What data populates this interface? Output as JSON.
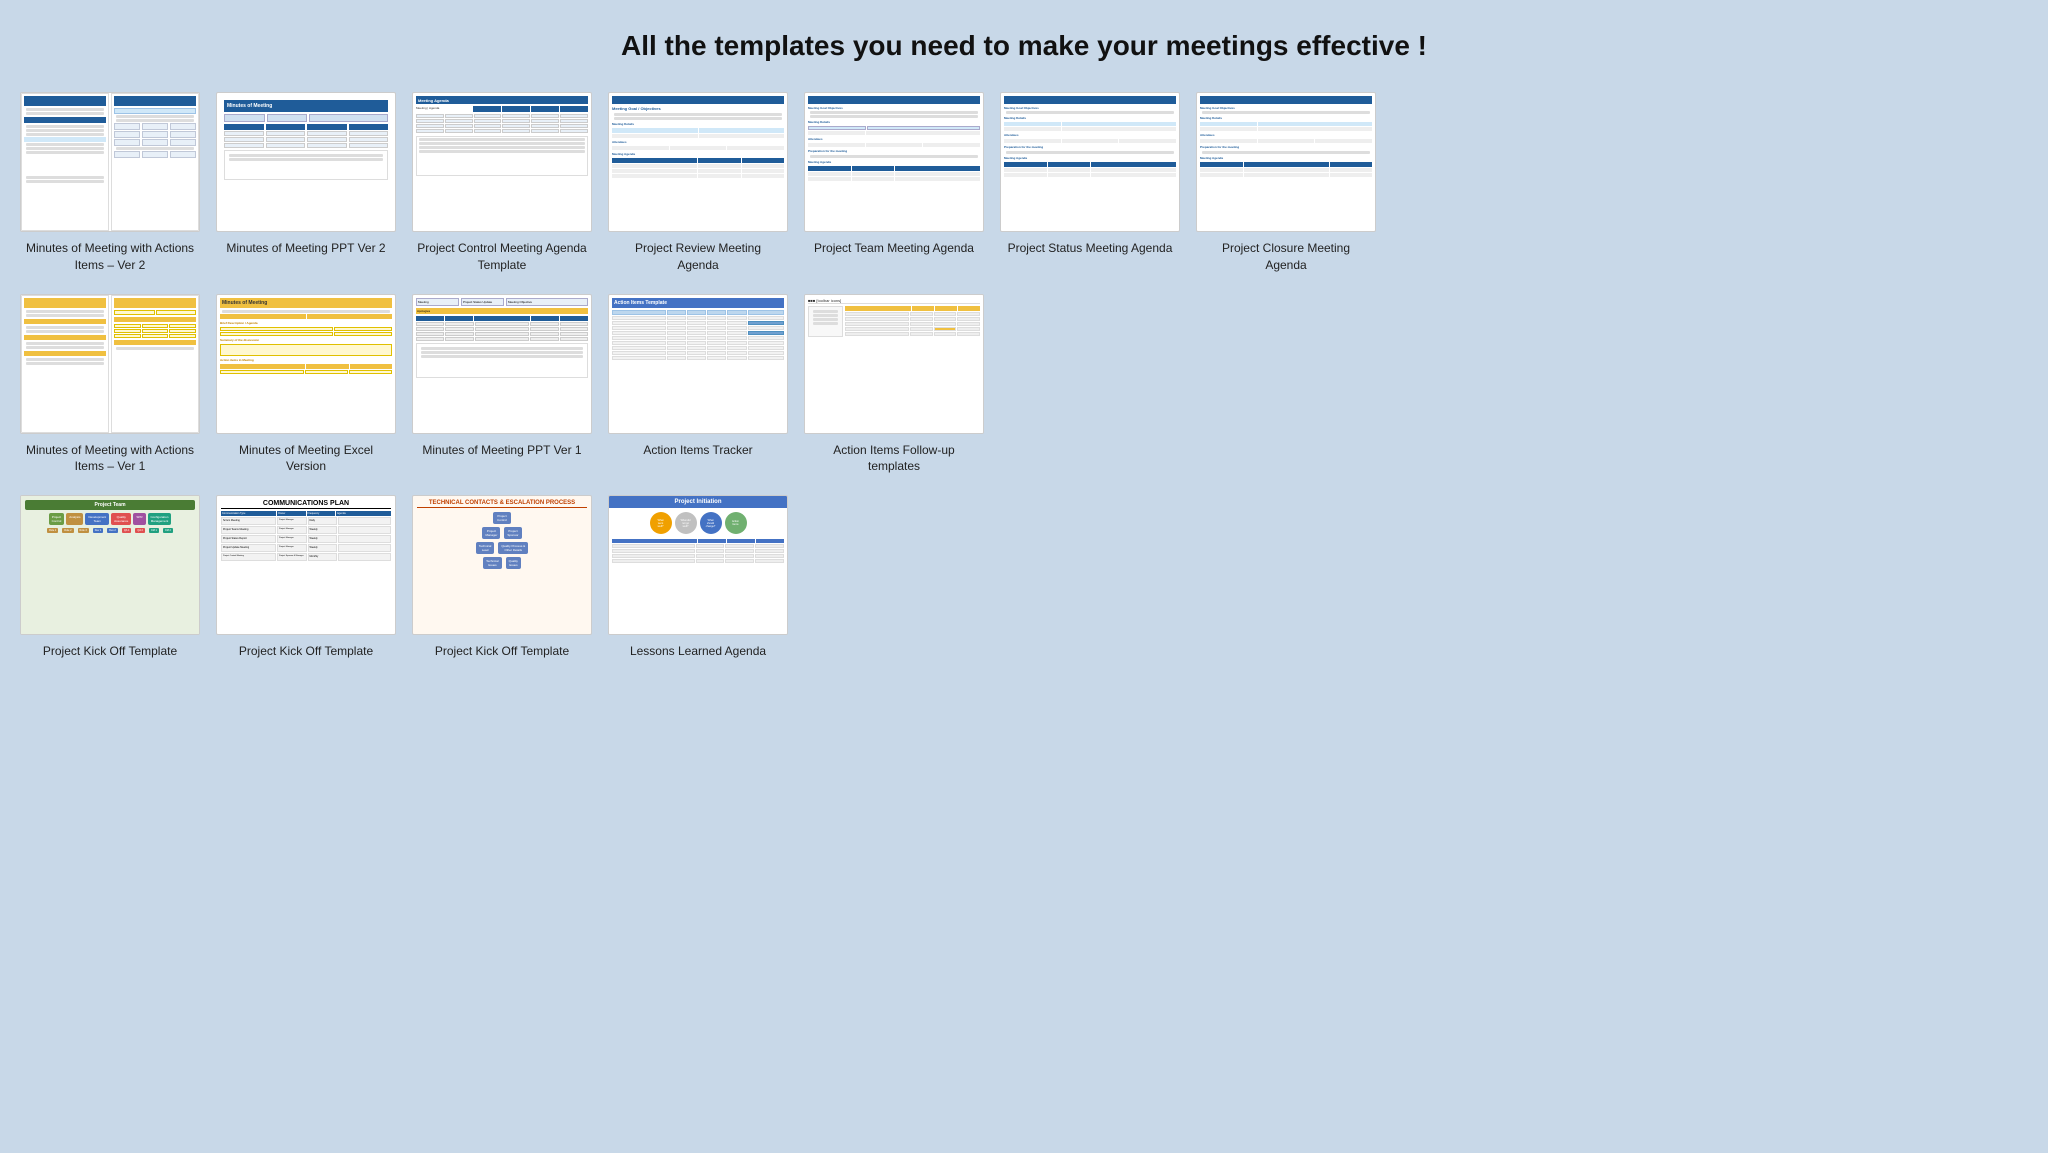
{
  "page": {
    "title": "All the templates you need to make your meetings effective !",
    "background_color": "#c8d8e8"
  },
  "rows": [
    {
      "id": "row1",
      "cards": [
        {
          "id": "c1",
          "label": "Minutes of Meeting with Actions Items – Ver 2",
          "thumb_type": "double-blue"
        },
        {
          "id": "c2",
          "label": "Minutes of Meeting PPT Ver 2",
          "thumb_type": "ppt-blue"
        },
        {
          "id": "c3",
          "label": "Project Control Meeting Agenda Template",
          "thumb_type": "blue-table"
        },
        {
          "id": "c4",
          "label": "Project Review Meeting Agenda",
          "thumb_type": "blue-table2"
        },
        {
          "id": "c5",
          "label": "Project Team Meeting Agenda",
          "thumb_type": "blue-table3"
        },
        {
          "id": "c6",
          "label": "Project Status Meeting Agenda",
          "thumb_type": "blue-table4"
        },
        {
          "id": "c7",
          "label": "Project Closure Meeting Agenda",
          "thumb_type": "blue-table5"
        }
      ]
    },
    {
      "id": "row2",
      "cards": [
        {
          "id": "c8",
          "label": "Minutes of Meeting with Actions Items – Ver 1",
          "thumb_type": "double-yellow"
        },
        {
          "id": "c9",
          "label": "Minutes of Meeting Excel Version",
          "thumb_type": "yellow-table"
        },
        {
          "id": "c10",
          "label": "Minutes of Meeting PPT Ver 1",
          "thumb_type": "ppt-meeting"
        },
        {
          "id": "c11",
          "label": "Action Items Tracker",
          "thumb_type": "action-tracker"
        },
        {
          "id": "c12",
          "label": "Action Items Follow-up templates",
          "thumb_type": "action-followup"
        }
      ]
    },
    {
      "id": "row3",
      "cards": [
        {
          "id": "c13",
          "label": "Project Kick Off Template",
          "thumb_type": "kickoff-org"
        },
        {
          "id": "c14",
          "label": "Project Kick Off Template",
          "thumb_type": "kickoff-comms"
        },
        {
          "id": "c15",
          "label": "Project Kick Off Template",
          "thumb_type": "kickoff-escalation"
        },
        {
          "id": "c16",
          "label": "Lessons Learned Agenda",
          "thumb_type": "lessons-learned"
        }
      ]
    }
  ],
  "colors": {
    "blue_dark": "#1f5c99",
    "blue_mid": "#4472c4",
    "yellow": "#f0c040",
    "green": "#6a8c3a",
    "orange": "#c8a060",
    "red_title": "#c04000"
  }
}
